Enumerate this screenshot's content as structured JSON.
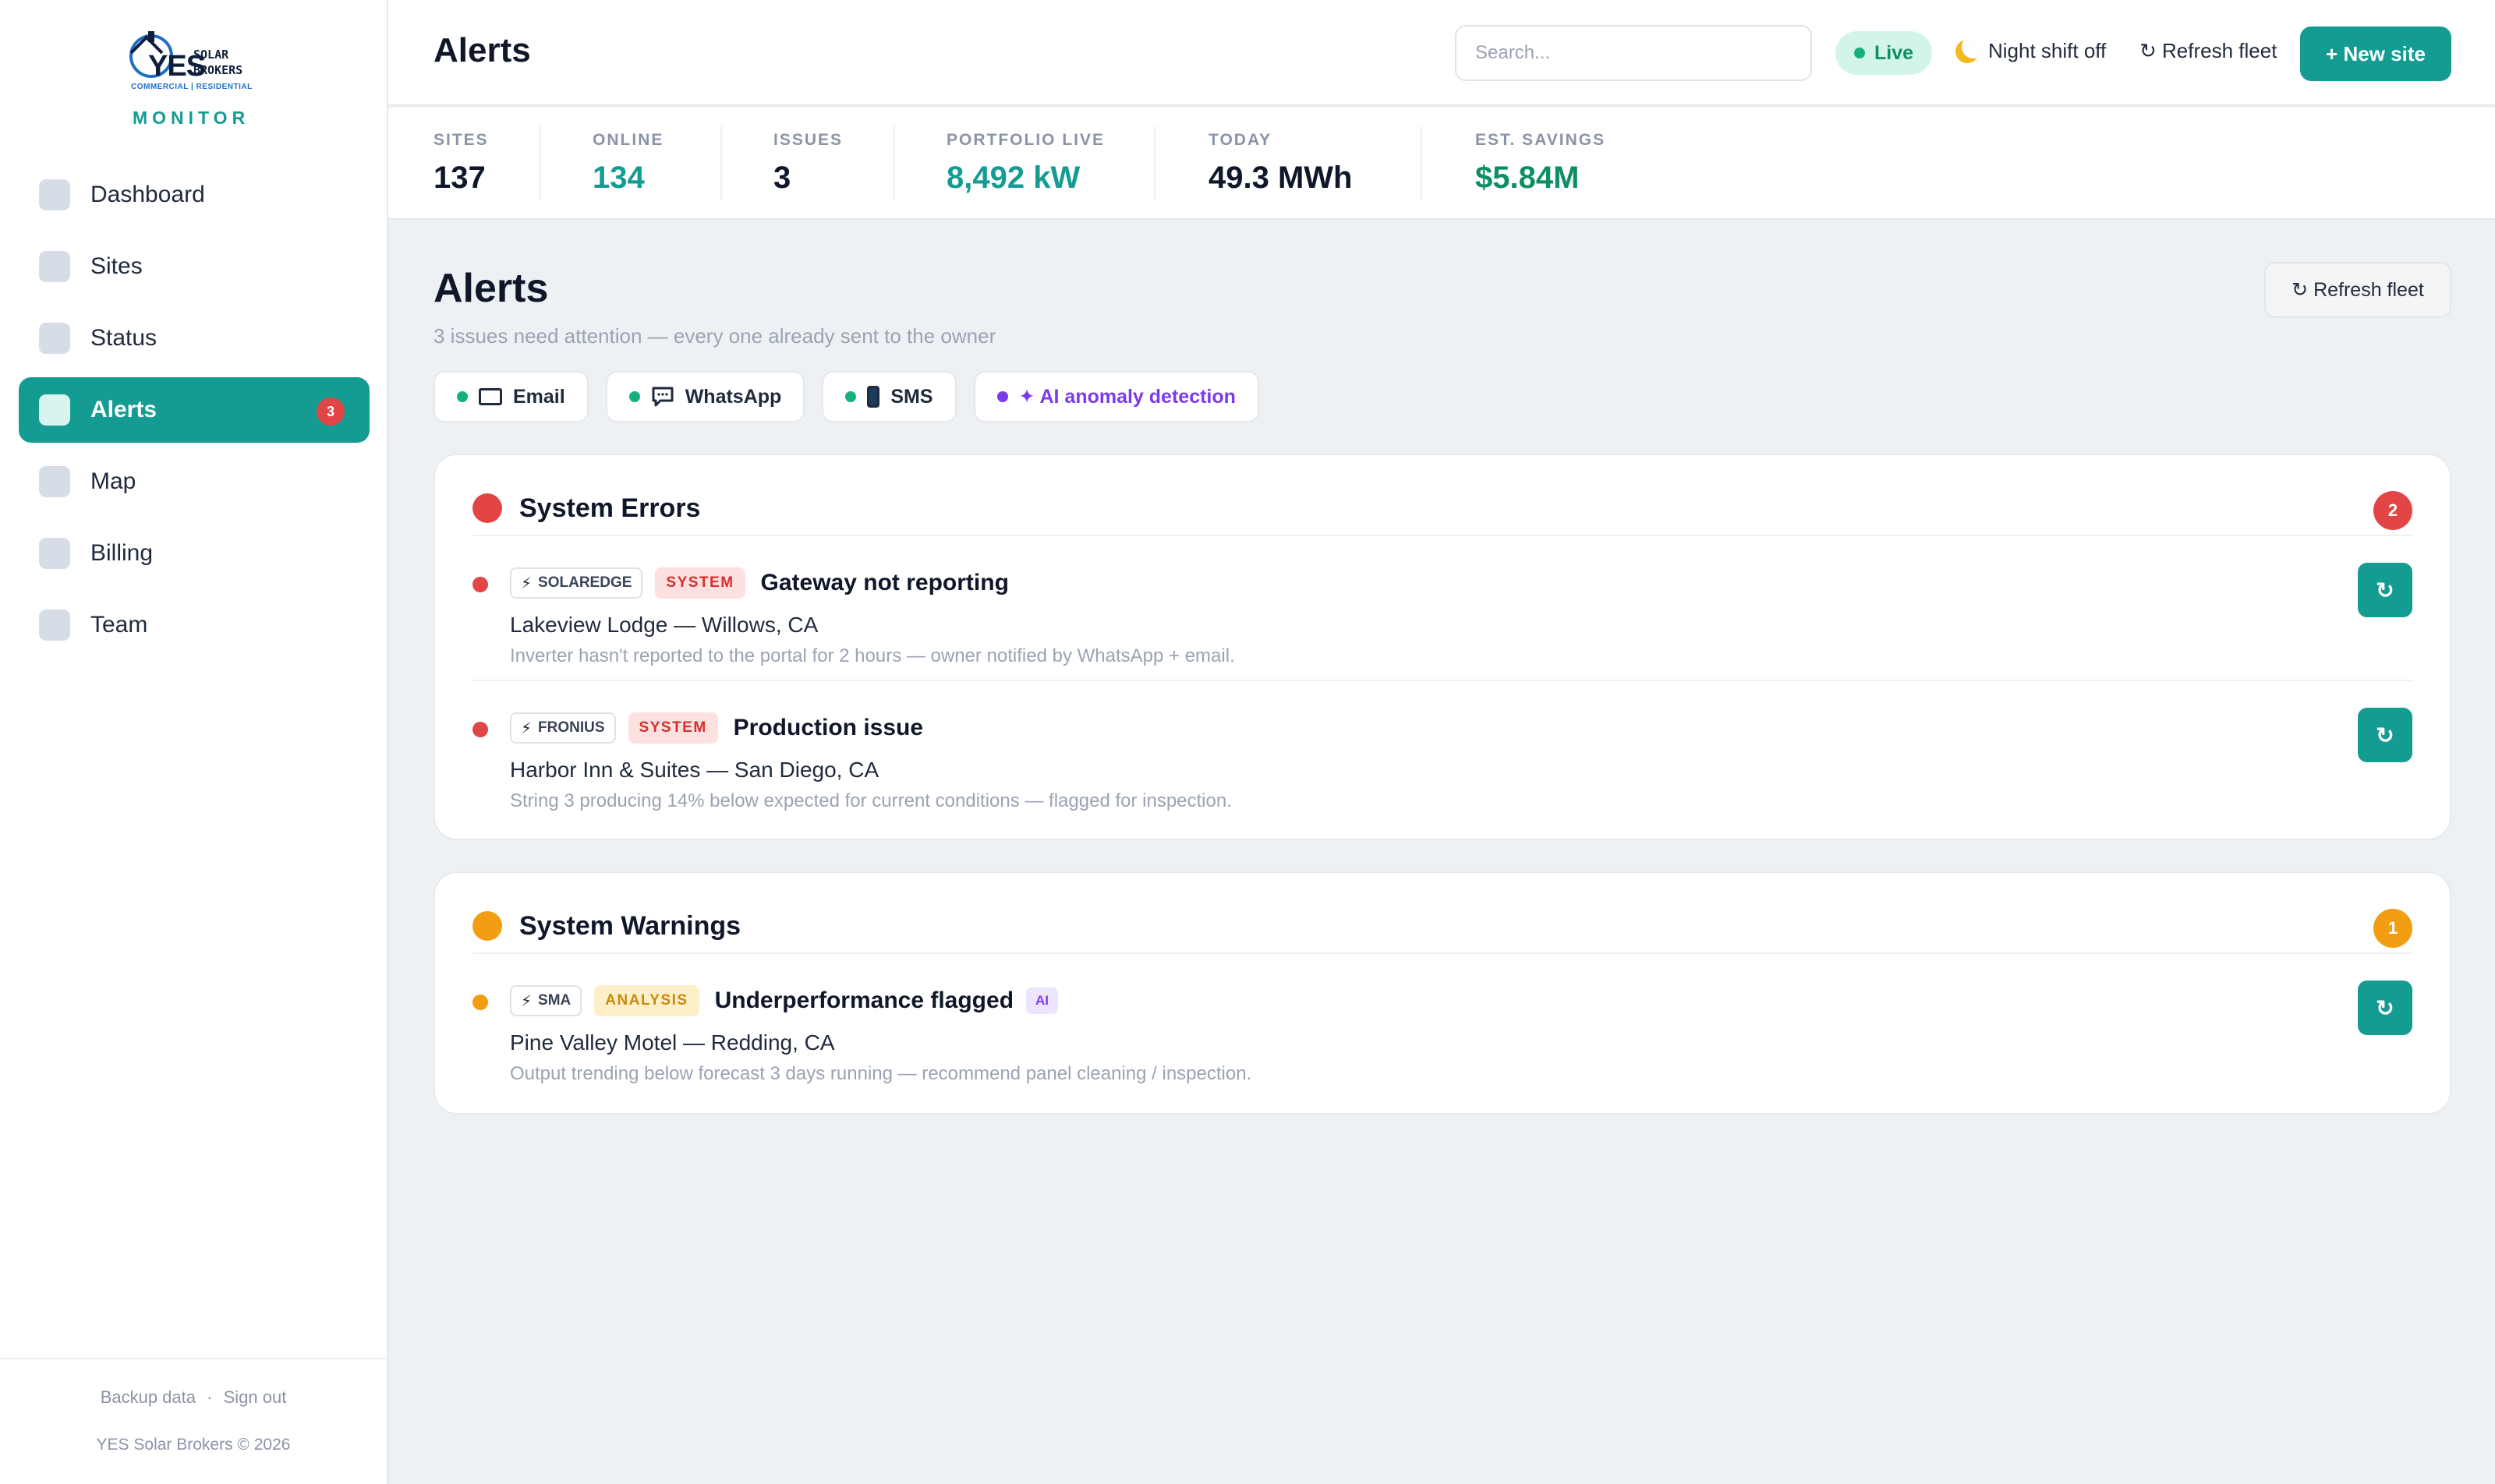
{
  "brand": {
    "logo_main": "YES",
    "logo_side_1": "SOLAR",
    "logo_side_2": "BROKERS",
    "logo_sub": "COMMERCIAL | RESIDENTIAL",
    "product": "MONITOR"
  },
  "sidebar": {
    "items": [
      {
        "label": "Dashboard",
        "active": false
      },
      {
        "label": "Sites",
        "active": false
      },
      {
        "label": "Status",
        "active": false
      },
      {
        "label": "Alerts",
        "active": true,
        "badge": "3"
      },
      {
        "label": "Map",
        "active": false
      },
      {
        "label": "Billing",
        "active": false
      },
      {
        "label": "Team",
        "active": false
      }
    ],
    "footer_links": [
      "Backup data",
      "Sign out"
    ],
    "footer_separator": "·",
    "copyright": "YES Solar Brokers © 2026"
  },
  "topbar": {
    "title": "Alerts",
    "search_placeholder": "Search...",
    "live_label": "Live",
    "night_label": "Night shift off",
    "refresh_label": "↻ Refresh fleet",
    "new_site_label": "+ New site"
  },
  "stats": [
    {
      "label": "SITES",
      "value": "137",
      "color": "#0f172a"
    },
    {
      "label": "ONLINE",
      "value": "134",
      "color": "#149c93"
    },
    {
      "label": "ISSUES",
      "value": "3",
      "color": "#0f172a"
    },
    {
      "label": "PORTFOLIO LIVE",
      "value": "8,492 kW",
      "color": "#149c93"
    },
    {
      "label": "TODAY",
      "value": "49.3 MWh",
      "color": "#0f172a"
    },
    {
      "label": "EST. SAVINGS",
      "value": "$5.84M",
      "color": "#0e8f62"
    }
  ],
  "main": {
    "title": "Alerts",
    "subtitle": "3 issues need attention — every one already sent to the owner",
    "refresh_label": "↻ Refresh fleet",
    "channels": [
      {
        "label": "Email",
        "icon": "envelope-icon"
      },
      {
        "label": "WhatsApp",
        "icon": "chat-icon"
      },
      {
        "label": "SMS",
        "icon": "phone-icon"
      },
      {
        "label": "✦ AI anomaly detection",
        "icon": "sparkle-icon"
      }
    ]
  },
  "errors": {
    "title": "System Errors",
    "count": "2",
    "color": "#e24545",
    "alerts": [
      {
        "vendor": "SOLAREDGE",
        "type": "SYSTEM",
        "title": "Gateway not reporting",
        "site": "Lakeview Lodge — Willows, CA",
        "desc": "Inverter hasn't reported to the portal for 2 hours — owner notified by WhatsApp + email."
      },
      {
        "vendor": "FRONIUS",
        "type": "SYSTEM",
        "title": "Production issue",
        "site": "Harbor Inn & Suites — San Diego, CA",
        "desc": "String 3 producing 14% below expected for current conditions — flagged for inspection."
      }
    ]
  },
  "warnings": {
    "title": "System Warnings",
    "count": "1",
    "color": "#f29d12",
    "alerts": [
      {
        "vendor": "SMA",
        "type": "ANALYSIS",
        "title": "Underperformance flagged",
        "ai_badge": "AI",
        "site": "Pine Valley Motel — Redding, CA",
        "desc": "Output trending below forecast 3 days running — recommend panel cleaning / inspection."
      }
    ]
  },
  "retry_icon": "↻",
  "vendor_icon": "⚡"
}
